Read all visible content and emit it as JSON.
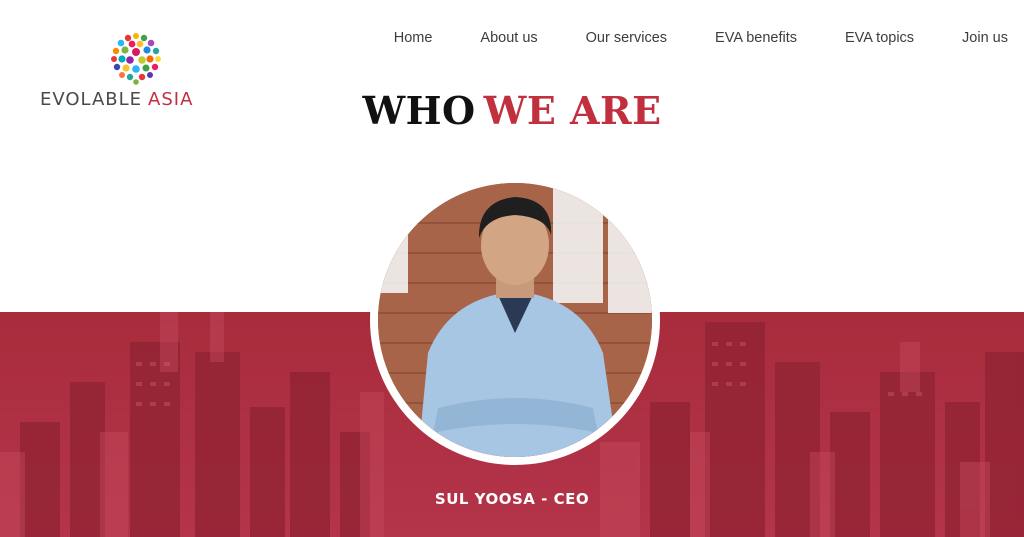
{
  "brand": {
    "name_part1": "EVOLABLE",
    "name_part2": "ASIA",
    "accent_color": "#c0303e",
    "logo_icon": "colorful-dot-globe-icon"
  },
  "nav": {
    "items": [
      {
        "label": "Home"
      },
      {
        "label": "About us"
      },
      {
        "label": "Our services"
      },
      {
        "label": "EVA benefits"
      },
      {
        "label": "EVA topics"
      },
      {
        "label": "Join us"
      }
    ]
  },
  "hero": {
    "title_part1": "WHO",
    "title_part2": "WE ARE",
    "band_color": "#a52a3a"
  },
  "profile": {
    "photo_icon": "person-portrait-photo",
    "caption": "SUL YOOSA - CEO"
  }
}
